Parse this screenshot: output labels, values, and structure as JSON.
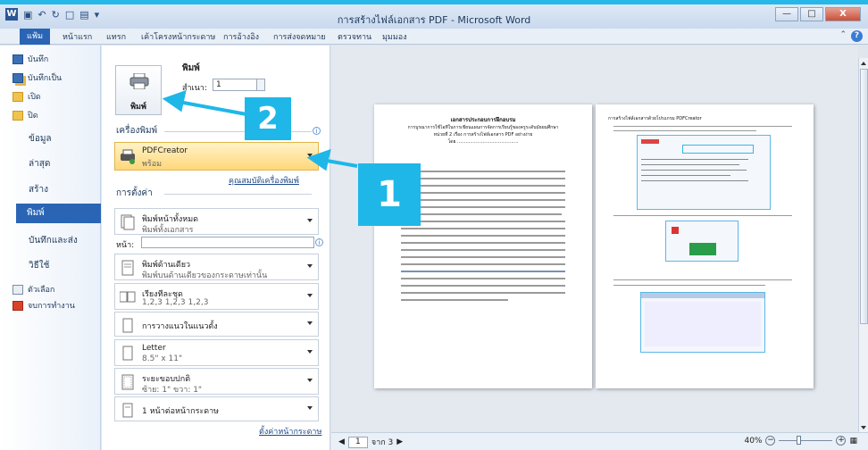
{
  "window": {
    "title": "การสร้างไฟล์เอกสาร PDF - Microsoft Word",
    "controls": [
      "minimize",
      "maximize",
      "close"
    ],
    "close_glyph": "X"
  },
  "quick_access": {
    "logo": "W"
  },
  "ribbon_tabs": {
    "file": "แฟ้ม",
    "items": [
      "หน้าแรก",
      "แทรก",
      "เค้าโครงหน้ากระดาษ",
      "การอ้างอิง",
      "การส่งจดหมาย",
      "ตรวจทาน",
      "มุมมอง"
    ],
    "help": "?"
  },
  "backstage_nav": {
    "quick_items": [
      {
        "label": "บันทึก",
        "icon": "save-icon"
      },
      {
        "label": "บันทึกเป็น",
        "icon": "save-as-icon"
      },
      {
        "label": "เปิด",
        "icon": "open-folder-icon"
      },
      {
        "label": "ปิด",
        "icon": "close-folder-icon"
      }
    ],
    "sections": [
      "ข้อมูล",
      "ล่าสุด",
      "สร้าง",
      "พิมพ์",
      "บันทึกและส่ง",
      "วิธีใช้"
    ],
    "active": "พิมพ์",
    "bottom_items": [
      {
        "label": "ตัวเลือก",
        "icon": "options-icon"
      },
      {
        "label": "จบการทำงาน",
        "icon": "exit-icon"
      }
    ]
  },
  "print_panel": {
    "heading": "พิมพ์",
    "copies_label": "สำเนา:",
    "copies_value": "1",
    "print_button": "พิมพ์",
    "printer_heading": "เครื่องพิมพ์",
    "printer_name": "PDFCreator",
    "printer_status": "พร้อม",
    "printer_properties_link": "คุณสมบัติเครื่องพิมพ์",
    "settings_heading": "การตั้งค่า",
    "settings": [
      {
        "l1": "พิมพ์หน้าทั้งหมด",
        "l2": "พิมพ์ทั้งเอกสาร",
        "icon": "pages-icon"
      },
      {
        "l1": "พิมพ์ด้านเดียว",
        "l2": "พิมพ์บนด้านเดียวของกระดาษเท่านั้น",
        "icon": "one-sided-icon"
      },
      {
        "l1": "เรียงทีละชุด",
        "l2": "1,2,3    1,2,3    1,2,3",
        "icon": "collate-icon"
      },
      {
        "l1": "การวางแนวในแนวตั้ง",
        "l2": "",
        "icon": "portrait-icon"
      },
      {
        "l1": "Letter",
        "l2": "8.5\" x 11\"",
        "icon": "paper-size-icon"
      },
      {
        "l1": "ระยะขอบปกติ",
        "l2": "ซ้าย:  1\"    ขวา:  1\"",
        "icon": "margins-icon"
      },
      {
        "l1": "1 หน้าต่อหน้ากระดาษ",
        "l2": "",
        "icon": "pages-per-sheet-icon"
      }
    ],
    "pages_label": "หน้า:",
    "page_setup_link": "ตั้งค่าหน้ากระดาษ"
  },
  "preview": {
    "page1": {
      "title": "เอกสารประกอบการฝึกอบรม",
      "subtitle": "การบูรณาการใช้ไอทีในการเขียนแผนการจัดการเรียนรู้ของครูระดับมัธยมศึกษา",
      "subtitle2": "หน่วยที่ 2 เรื่อง การสร้างไฟล์เอกสาร PDF อย่างง่าย",
      "author": "โดย ..........................................."
    },
    "page2": {
      "intro": "การสร้างไฟล์เอกสารด้วยโปรแกรม PDFCreator"
    }
  },
  "status": {
    "page_current": "1",
    "page_of": "จาก 3",
    "zoom": "40%"
  },
  "callouts": {
    "one": "1",
    "two": "2"
  }
}
